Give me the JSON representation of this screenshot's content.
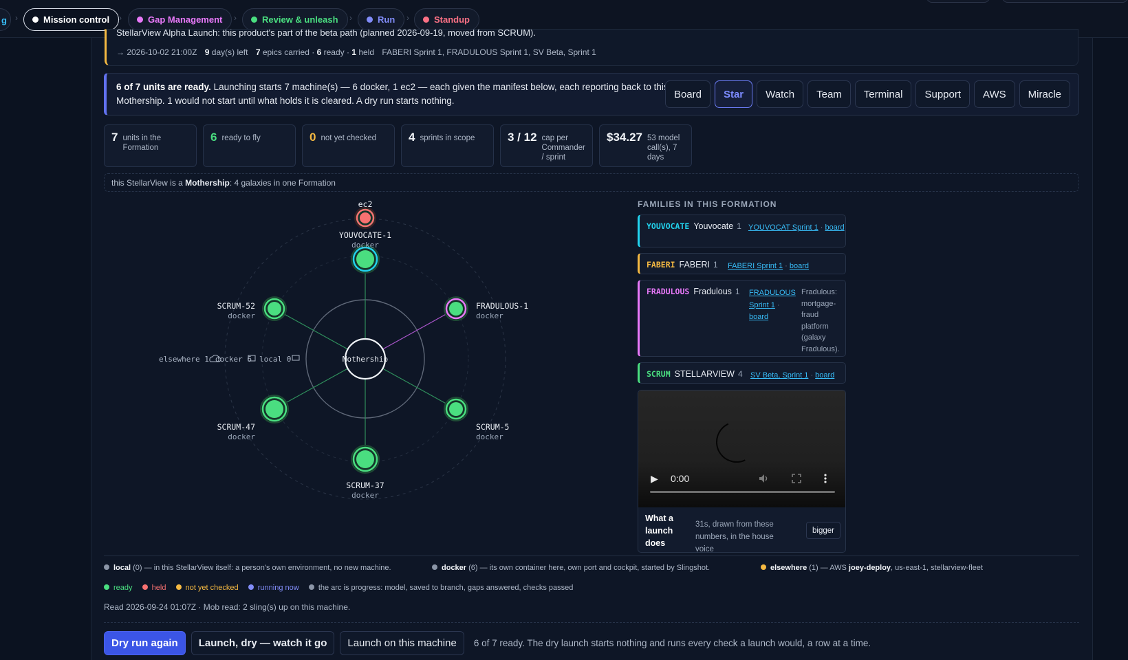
{
  "nav": {
    "edge_label": "g",
    "pills": [
      {
        "label": "Mission control",
        "color": "#ffffff",
        "dot": "#ffffff"
      },
      {
        "label": "Gap Management",
        "color": "#e879f9",
        "dot": "#e879f9"
      },
      {
        "label": "Review & unleash",
        "color": "#4ade80",
        "dot": "#4ade80"
      },
      {
        "label": "Run",
        "color": "#818cf8",
        "dot": "#818cf8"
      },
      {
        "label": "Standup",
        "color": "#fb7185",
        "dot": "#fb7185"
      }
    ],
    "separator": "›"
  },
  "release": {
    "cut_line": "StellarView Alpha Launch: this product's part of the beta path (planned 2026-09-19, moved from SCRUM).",
    "target": "→ 2026-10-02 21:00Z",
    "days_left_num": "9",
    "days_left_txt": "day(s) left",
    "epics_num": "7",
    "epics_txt": "epics carried ·",
    "ready_num": "6",
    "ready_txt": "ready ·",
    "held_num": "1",
    "held_txt": "held",
    "sprints": "FABERI Sprint 1, FRADULOUS Sprint 1, SV Beta, Sprint 1"
  },
  "callout": {
    "bold": "6 of 7 units are ready.",
    "text": " Launching starts 7 machine(s) — 6 docker, 1 ec2 — each given the manifest below, each reporting back to this Mothership. 1 would not start until what holds it is cleared. A dry run starts nothing.",
    "tabs": [
      "Board",
      "Star",
      "Watch",
      "Team",
      "Terminal",
      "Support",
      "AWS",
      "Miracle"
    ],
    "active_tab": "Star"
  },
  "stats": [
    {
      "num": "7",
      "label": "units in the Formation",
      "tone": "white"
    },
    {
      "num": "6",
      "label": "ready to fly",
      "tone": "green"
    },
    {
      "num": "0",
      "label": "not yet checked",
      "tone": "amber"
    },
    {
      "num": "4",
      "label": "sprints in scope",
      "tone": "white"
    },
    {
      "num": "3 / 12",
      "label": "cap per Commander / sprint",
      "tone": "white"
    },
    {
      "num": "$34.27",
      "label": "53 model call(s), 7 days",
      "tone": "white"
    }
  ],
  "mothership_note": {
    "pre": "this StellarView is a ",
    "bold": "Mothership",
    "post": ": 4 galaxies in one Formation"
  },
  "orbit": {
    "center_label": "Mothership",
    "ring_labels": [
      {
        "text": "elsewhere 1",
        "icon": "cloud-icon"
      },
      {
        "text": "docker 6",
        "icon": "container-icon"
      },
      {
        "text": "local 0",
        "icon": "monitor-icon"
      }
    ],
    "nodes": [
      {
        "name": "YOUVOCATE-1",
        "kind": "docker",
        "status": "ready",
        "fill": "#4ade80",
        "ring": "#22d3ee"
      },
      {
        "name": "FRADULOUS-1",
        "kind": "docker",
        "status": "ready",
        "fill": "#4ade80",
        "ring": "#e879f9"
      },
      {
        "name": "SCRUM-5",
        "kind": "docker",
        "status": "ready",
        "fill": "#4ade80",
        "ring": "#4ade80"
      },
      {
        "name": "SCRUM-37",
        "kind": "docker",
        "status": "ready",
        "fill": "#4ade80",
        "ring": "#4ade80"
      },
      {
        "name": "SCRUM-47",
        "kind": "docker",
        "status": "ready",
        "fill": "#4ade80",
        "ring": "#4ade80"
      },
      {
        "name": "SCRUM-52",
        "kind": "docker",
        "status": "ready",
        "fill": "#4ade80",
        "ring": "#4ade80"
      },
      {
        "name": "ec2",
        "kind": "",
        "status": "held",
        "fill": "#f87171",
        "ring": "#f87171"
      }
    ]
  },
  "families": {
    "title": "FAMILIES IN THIS FORMATION",
    "items": [
      {
        "code": "YOUVOCATE",
        "name": "Youvocate",
        "count": "1",
        "sprint": "YOUVOCAT Sprint 1",
        "board": "board",
        "desc": "",
        "color": "#22d3ee"
      },
      {
        "code": "FABERI",
        "name": "FABERI",
        "count": "1",
        "sprint": "FABERI Sprint 1",
        "board": "board",
        "desc": "",
        "color": "#f5b942"
      },
      {
        "code": "FRADULOUS",
        "name": "Fradulous",
        "count": "1",
        "sprint": "FRADULOUS Sprint 1",
        "board": "board",
        "desc": "Fradulous: mortgage-fraud platform (galaxy Fradulous).",
        "color": "#e879f9"
      },
      {
        "code": "SCRUM",
        "name": "STELLARVIEW",
        "count": "4",
        "sprint": "SV Beta, Sprint 1",
        "board": "board",
        "desc": "",
        "color": "#4ade80"
      }
    ]
  },
  "video": {
    "time": "0:00",
    "caption": "What a launch does",
    "note": "31s, drawn from these numbers, in the house voice",
    "bigger": "bigger"
  },
  "legend": {
    "local_name": "local",
    "local_text": " (0) — in this StellarView itself: a person's own environment, no new machine.",
    "docker_name": "docker",
    "docker_text": " (6) — its own container here, own port and cockpit, started by Slingshot.",
    "elsewhere_name": "elsewhere",
    "elsewhere_text_1": " (1) — AWS ",
    "elsewhere_bold": "joey-deploy",
    "elsewhere_text_2": ", us-east-1, stellarview-fleet",
    "status": [
      {
        "label": "ready",
        "color": "#4ade80"
      },
      {
        "label": "held",
        "color": "#f87171"
      },
      {
        "label": "not yet checked",
        "color": "#f5b942"
      },
      {
        "label": "running now",
        "color": "#818cf8"
      }
    ],
    "arc_note": "the arc is progress: model, saved to branch, gaps answered, checks passed",
    "colors": {
      "local": "#8b95a7",
      "docker": "#8b95a7",
      "elsewhere": "#f5b942",
      "arc": "#8b95a7"
    }
  },
  "read_line": "Read 2026-09-24 01:07Z · Mob read: 2 sling(s) up on this machine.",
  "actions": {
    "dry_run_again": "Dry run again",
    "launch_dry": "Launch, dry — watch it go",
    "launch_here": "Launch on this machine",
    "note": "6 of 7 ready. The dry launch starts nothing and runs every check a launch would, a row at a time."
  }
}
